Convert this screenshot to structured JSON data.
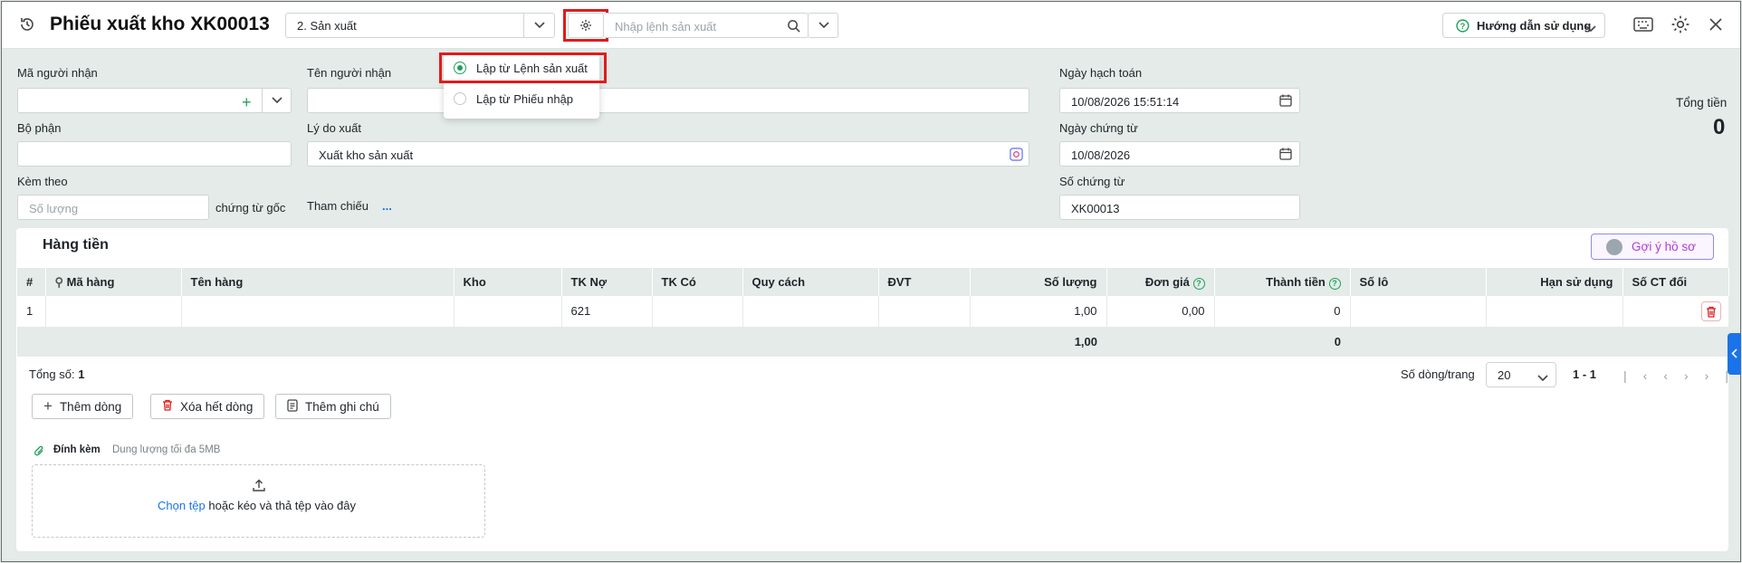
{
  "header": {
    "title": "Phiếu xuất kho XK00013",
    "type_select": "2. Sản xuất",
    "order_placeholder": "Nhập lệnh sản xuất",
    "guide_label": "Hướng dẫn sử dụng"
  },
  "dropdown": {
    "option1": "Lập từ Lệnh sản xuất",
    "option2": "Lập từ Phiếu nhập",
    "selected": "option1"
  },
  "form": {
    "recipient_code_label": "Mã người nhận",
    "recipient_name_label": "Tên người nhận",
    "department_label": "Bộ phận",
    "reason_label": "Lý do xuất",
    "reason_value": "Xuất kho sản xuất",
    "attach_label": "Kèm theo",
    "attach_placeholder": "Số lượng",
    "original_docs_label": "chứng từ gốc",
    "reference_label": "Tham chiếu",
    "reference_value": "...",
    "posting_date_label": "Ngày hạch toán",
    "posting_date_value": "10/08/2026 15:51:14",
    "doc_date_label": "Ngày chứng từ",
    "doc_date_value": "10/08/2026",
    "doc_no_label": "Số chứng từ",
    "doc_no_value": "XK00013",
    "total_label": "Tổng tiền",
    "total_value": "0"
  },
  "section": {
    "title": "Hàng tiền",
    "suggest_label": "Gợi ý hồ sơ"
  },
  "table": {
    "columns": [
      "#",
      "Mã hàng",
      "Tên hàng",
      "Kho",
      "TK Nợ",
      "TK Có",
      "Quy cách",
      "ĐVT",
      "Số lượng",
      "Đơn giá",
      "Thành tiền",
      "Số lô",
      "Hạn sử dụng",
      "Số CT đối"
    ],
    "rows": [
      {
        "no": "1",
        "item_code": "",
        "item_name": "",
        "warehouse": "",
        "debit": "621",
        "credit": "",
        "spec": "",
        "unit": "",
        "qty": "1,00",
        "price": "0,00",
        "amount": "0",
        "lot": "",
        "expiry": "",
        "ref_doc": ""
      }
    ],
    "totals": {
      "qty": "1,00",
      "amount": "0"
    }
  },
  "footer": {
    "count_label": "Tổng số:",
    "count_value": "1",
    "rows_per_page_label": "Số dòng/trang",
    "rows_per_page": "20",
    "range": "1 - 1",
    "add_row": "Thêm dòng",
    "delete_all": "Xóa hết dòng",
    "add_note": "Thêm ghi chú"
  },
  "attachment": {
    "label": "Đính kèm",
    "limit": "Dung lượng tối đa 5MB",
    "choose": "Chọn tệp",
    "drag_text": "hoặc kéo và thả tệp vào đây"
  },
  "colors": {
    "accent": "#1a73e8",
    "green": "#20a05a",
    "red": "#e01b1b"
  }
}
